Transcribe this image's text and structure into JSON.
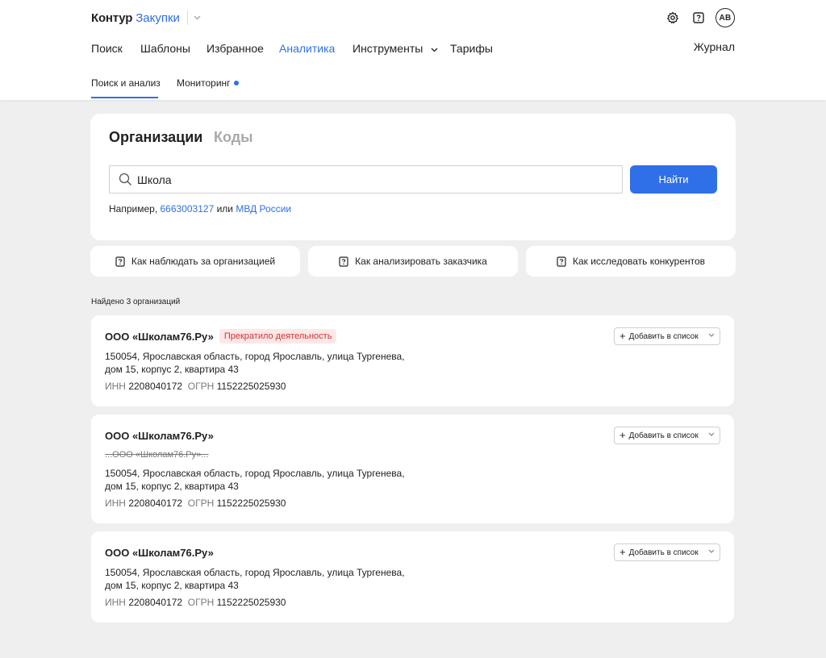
{
  "header": {
    "brand_primary": "Контур",
    "brand_secondary": "Закупки",
    "avatar_initials": "АВ",
    "icons": [
      "settings-icon",
      "help-icon"
    ]
  },
  "nav": {
    "items": [
      "Поиск",
      "Шаблоны",
      "Избранное",
      "Аналитика",
      "Инструменты",
      "Тарифы"
    ],
    "active": "Аналитика",
    "journal": "Журнал"
  },
  "subtabs": {
    "items": [
      "Поиск и анализ",
      "Мониторинг"
    ],
    "active": "Поиск и анализ"
  },
  "search": {
    "tab_organizations": "Организации",
    "tab_codes": "Коды",
    "query": "Школа",
    "button": "Найти",
    "example_prefix": "Например,",
    "example_link1": "6663003127",
    "example_or": "или",
    "example_link2": "МВД России"
  },
  "help": [
    "Как наблюдать за организацией",
    "Как анализировать заказчика",
    "Как исследовать конкурентов"
  ],
  "results": {
    "found_text": "Найдено 3 организаций",
    "add_label": "Добавить в список",
    "inn_label": "ИНН",
    "ogrn_label": "ОГРН",
    "items": [
      {
        "name": "ООО «Школам76.Ру»",
        "status": "Прекратило деятельность",
        "old_name": "",
        "address_line1": "150054, Ярославская область, город Ярославль, улица Тургенева,",
        "address_line2": "дом 15, корпус 2, квартира 43",
        "inn": "2208040172",
        "ogrn": "1152225025930"
      },
      {
        "name": "ООО «Школам76.Ру»",
        "status": "",
        "old_name": "...ООО «Школам76.Ру»...",
        "address_line1": "150054, Ярославская область, город Ярославль, улица Тургенева,",
        "address_line2": "дом 15, корпус 2, квартира 43",
        "inn": "2208040172",
        "ogrn": "1152225025930"
      },
      {
        "name": "ООО «Школам76.Ру»",
        "status": "",
        "old_name": "",
        "address_line1": "150054, Ярославская область, город Ярославль, улица Тургенева,",
        "address_line2": "дом 15, корпус 2, квартира 43",
        "inn": "2208040172",
        "ogrn": "1152225025930"
      }
    ]
  },
  "colors": {
    "accent": "#2f6fe8",
    "status_bg": "#fde7e7",
    "status_text": "#d23232",
    "page_bg": "#efefef"
  }
}
